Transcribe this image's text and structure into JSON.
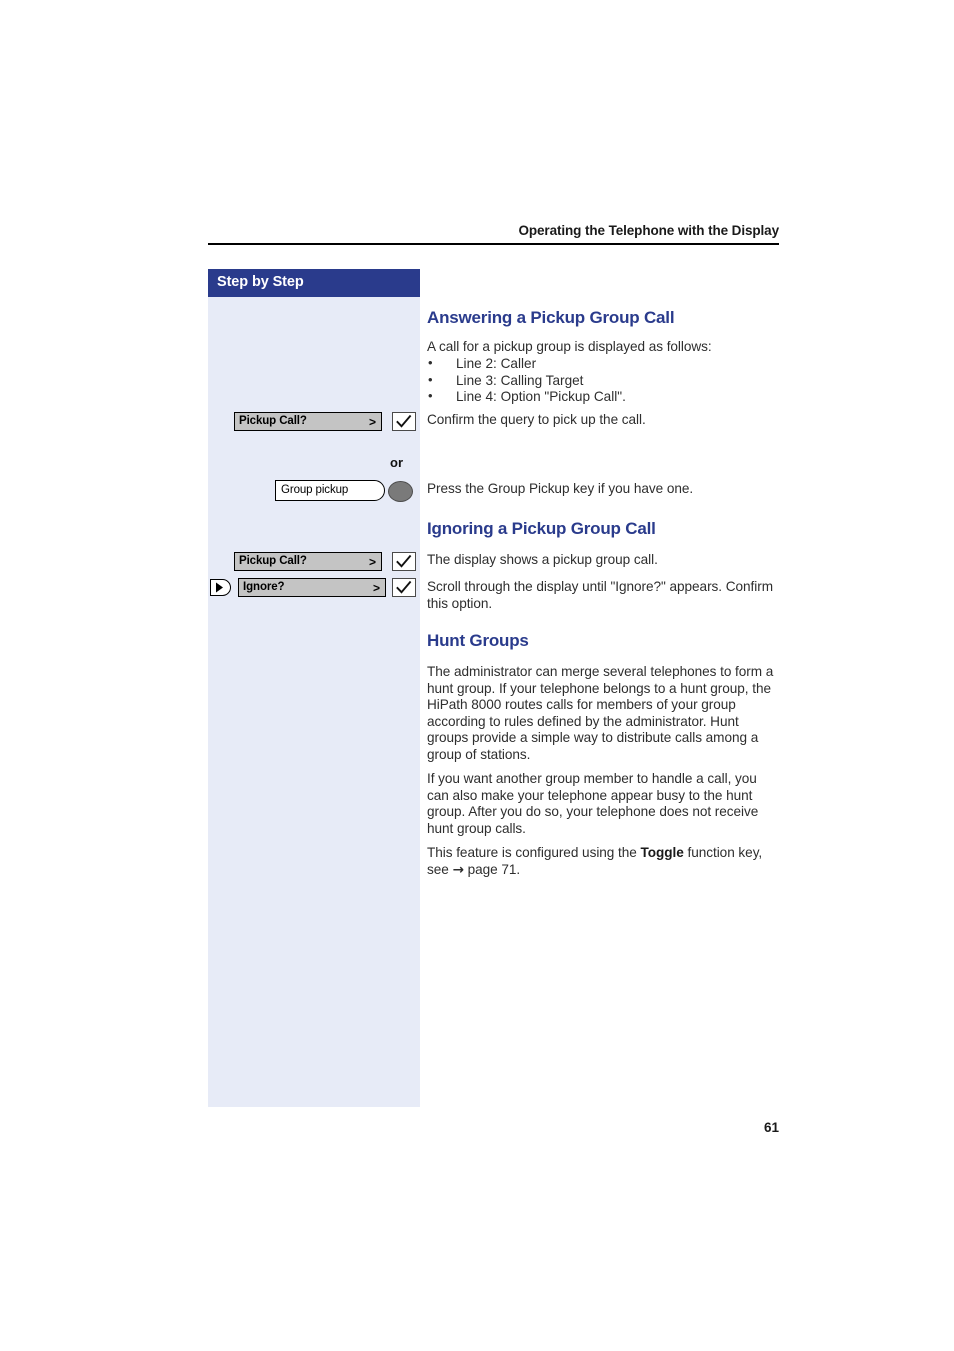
{
  "header": {
    "running_title": "Operating the Telephone with the Display"
  },
  "sidebar": {
    "title": "Step by Step",
    "or_label": "or",
    "rows": [
      {
        "type": "softkey",
        "label": "Pickup Call?",
        "arrow": ">",
        "confirm_icon": "check-icon"
      },
      {
        "type": "function-key",
        "label": "Group pickup",
        "key_icon": "oval-key-icon"
      },
      {
        "type": "softkey",
        "label": "Pickup Call?",
        "arrow": ">",
        "confirm_icon": "check-icon"
      },
      {
        "type": "softkey-scroll",
        "scroll_icon": "scroll-right-icon",
        "label": "Ignore?",
        "arrow": ">",
        "confirm_icon": "check-icon"
      }
    ]
  },
  "content": {
    "section1": {
      "title": "Answering a Pickup Group Call",
      "intro": "A call for a pickup group is displayed as follows:",
      "bullets": [
        "Line 2: Caller",
        "Line 3: Calling Target",
        "Line 4: Option \"Pickup Call\"."
      ],
      "confirm_text": "Confirm the query to pick up the call.",
      "group_key_text": "Press the Group Pickup key if you have one."
    },
    "section2": {
      "title": "Ignoring a Pickup Group Call",
      "para1": "The display shows a pickup group call.",
      "para2": "Scroll through the display until \"Ignore?\" appears. Confirm this option."
    },
    "section3": {
      "title": "Hunt Groups",
      "para1": "The administrator can merge several telephones to form a hunt group. If your telephone belongs to a hunt group, the HiPath 8000 routes calls for members of your group according to rules defined by the administrator. Hunt groups provide a simple way to distribute calls among a group of stations.",
      "para2": "If you want another group member to handle a call, you can also make your telephone appear busy to the hunt group. After you do so, your telephone does not receive hunt group calls.",
      "para3_pre": "This feature is configured using the ",
      "para3_bold": "Toggle",
      "para3_mid": " function key, see ",
      "para3_arrow": "→",
      "para3_post": " page 71."
    }
  },
  "folio": {
    "page_number": "61"
  },
  "colors": {
    "brand_blue": "#2a3b8c",
    "sidebar_bg": "#e7ebf7",
    "softkey_gray": "#c4c4c4",
    "oval_key_gray": "#7a7a7a"
  }
}
